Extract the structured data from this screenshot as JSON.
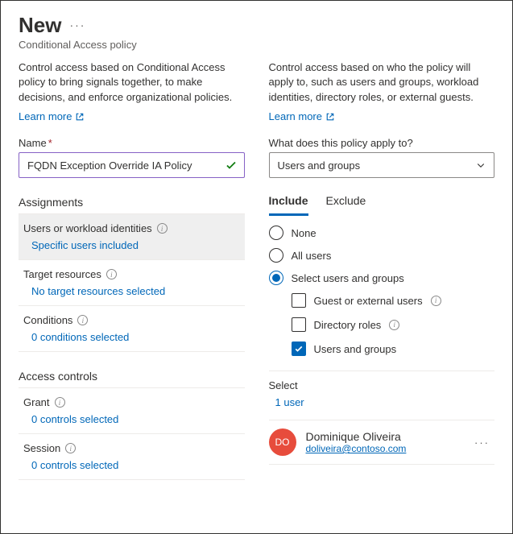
{
  "header": {
    "title": "New",
    "subtitle": "Conditional Access policy"
  },
  "left": {
    "intro": "Control access based on Conditional Access policy to bring signals together, to make decisions, and enforce organizational policies.",
    "learnMore": "Learn more",
    "nameLabel": "Name",
    "nameValue": "FQDN Exception Override IA Policy",
    "sections": {
      "assignments": "Assignments",
      "accessControls": "Access controls"
    },
    "rows": {
      "users": {
        "title": "Users or workload identities",
        "value": "Specific users included"
      },
      "target": {
        "title": "Target resources",
        "value": "No target resources selected"
      },
      "conditions": {
        "title": "Conditions",
        "value": "0 conditions selected"
      },
      "grant": {
        "title": "Grant",
        "value": "0 controls selected"
      },
      "session": {
        "title": "Session",
        "value": "0 controls selected"
      }
    }
  },
  "right": {
    "intro": "Control access based on who the policy will apply to, such as users and groups, workload identities, directory roles, or external guests.",
    "learnMore": "Learn more",
    "applyToLabel": "What does this policy apply to?",
    "applyToValue": "Users and groups",
    "tabs": {
      "include": "Include",
      "exclude": "Exclude"
    },
    "radios": {
      "none": "None",
      "allUsers": "All users",
      "selectUsers": "Select users and groups"
    },
    "checkboxes": {
      "guest": "Guest or external users",
      "directoryRoles": "Directory roles",
      "usersGroups": "Users and groups"
    },
    "selectLabel": "Select",
    "selectValue": "1 user",
    "user": {
      "initials": "DO",
      "name": "Dominique Oliveira",
      "email": "doliveira@contoso.com"
    }
  }
}
